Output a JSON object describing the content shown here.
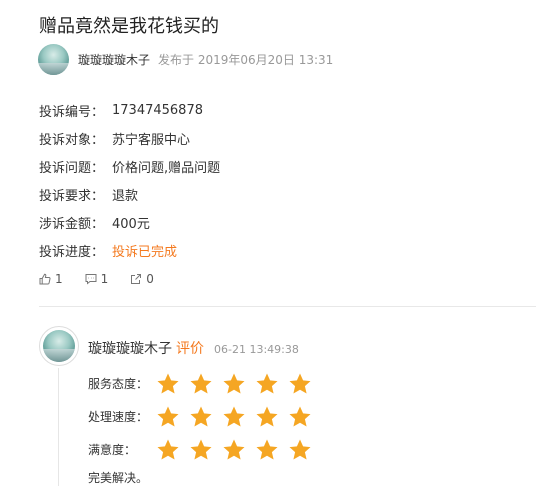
{
  "title": "赠品竟然是我花钱买的",
  "author": {
    "name": "璇璇璇璇木子",
    "meta": "发布于 2019年06月20日 13:31"
  },
  "info": [
    {
      "label": "投诉编号：",
      "value": "17347456878"
    },
    {
      "label": "投诉对象：",
      "value": "苏宁客服中心"
    },
    {
      "label": "投诉问题：",
      "value": "价格问题,赠品问题"
    },
    {
      "label": "投诉要求：",
      "value": "退款"
    },
    {
      "label": "涉诉金额：",
      "value": "400元"
    },
    {
      "label": "投诉进度：",
      "value": "投诉已完成"
    }
  ],
  "actions": {
    "likes": "1",
    "comments": "1",
    "shares": "0"
  },
  "review": {
    "name": "璇璇璇璇木子",
    "action": "评价",
    "time": "06-21 13:49:38",
    "ratings": [
      {
        "label": "服务态度：",
        "stars": 5
      },
      {
        "label": "处理速度：",
        "stars": 5
      },
      {
        "label": "满意度：",
        "stars": 5
      }
    ],
    "comment": "完美解决。"
  },
  "colors": {
    "accent": "#f47a20",
    "star": "#f5a623"
  }
}
